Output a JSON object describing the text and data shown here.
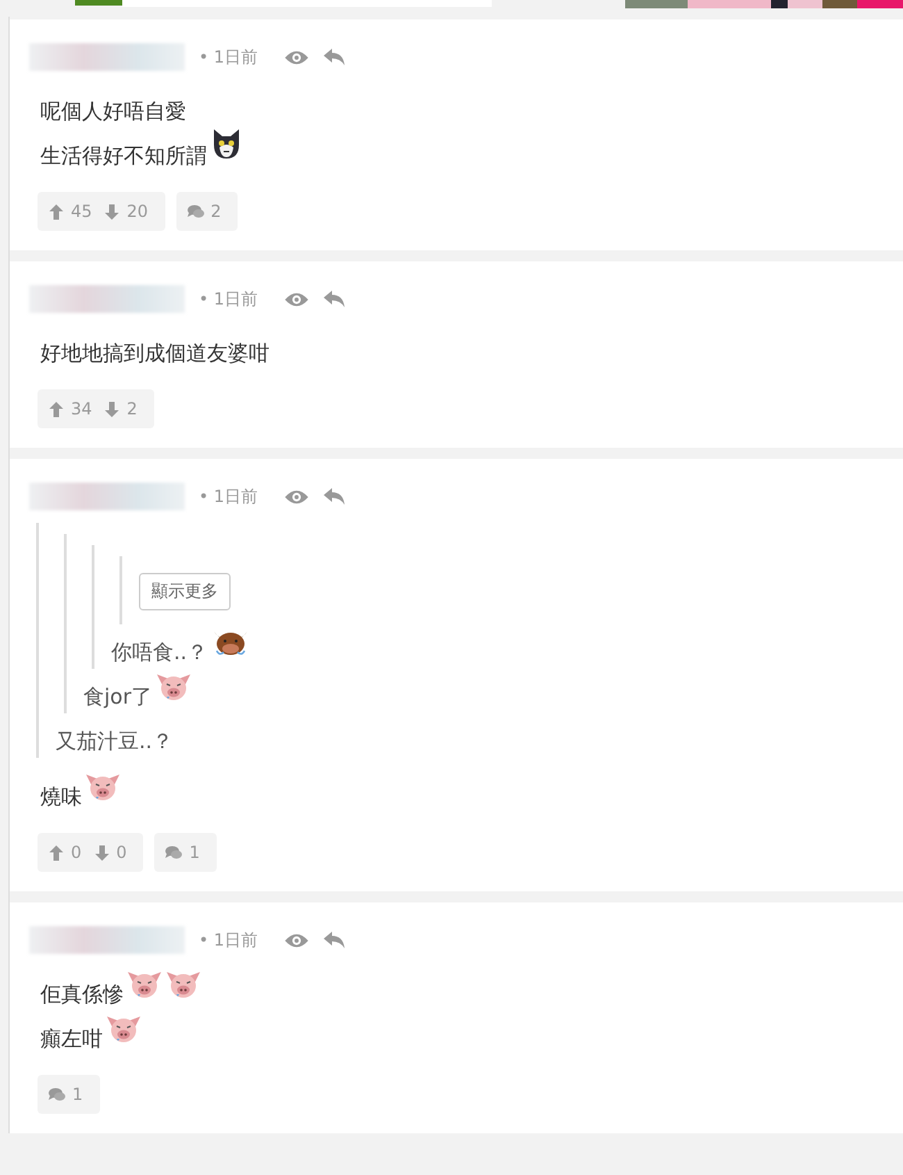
{
  "comments": [
    {
      "time": "• 1日前",
      "lines": [
        [
          {
            "kind": "text",
            "text": "呢個人好唔自愛"
          }
        ],
        [
          {
            "kind": "text",
            "text": "生活得好不知所謂"
          },
          {
            "kind": "cat"
          }
        ]
      ],
      "votes": {
        "up": "45",
        "down": "20"
      },
      "replies": "2"
    },
    {
      "time": "• 1日前",
      "lines": [
        [
          {
            "kind": "text",
            "text": "好地地搞到成個道友婆咁"
          }
        ]
      ],
      "votes": {
        "up": "34",
        "down": "2"
      }
    },
    {
      "time": "• 1日前",
      "quote": {
        "lines": [
          [
            {
              "kind": "text",
              "text": "又茄汁豆..？"
            }
          ]
        ],
        "children": [
          {
            "lines": [
              [
                {
                  "kind": "text",
                  "text": "食jor了"
                },
                {
                  "kind": "pig"
                }
              ]
            ],
            "children": [
              {
                "lines": [
                  [
                    {
                      "kind": "text",
                      "text": "你唔食..？"
                    },
                    {
                      "kind": "ox"
                    }
                  ]
                ],
                "children": [
                  {
                    "show_more": "顯示更多"
                  }
                ]
              }
            ]
          }
        ]
      },
      "lines": [
        [
          {
            "kind": "text",
            "text": "燒味"
          },
          {
            "kind": "pig"
          }
        ]
      ],
      "votes": {
        "up": "0",
        "down": "0"
      },
      "replies": "1"
    },
    {
      "time": "• 1日前",
      "lines": [
        [
          {
            "kind": "text",
            "text": "佢真係慘"
          },
          {
            "kind": "pig"
          },
          {
            "kind": "pig"
          }
        ],
        [
          {
            "kind": "text",
            "text": "癲左咁"
          },
          {
            "kind": "pig"
          }
        ]
      ],
      "replies": "1"
    }
  ]
}
